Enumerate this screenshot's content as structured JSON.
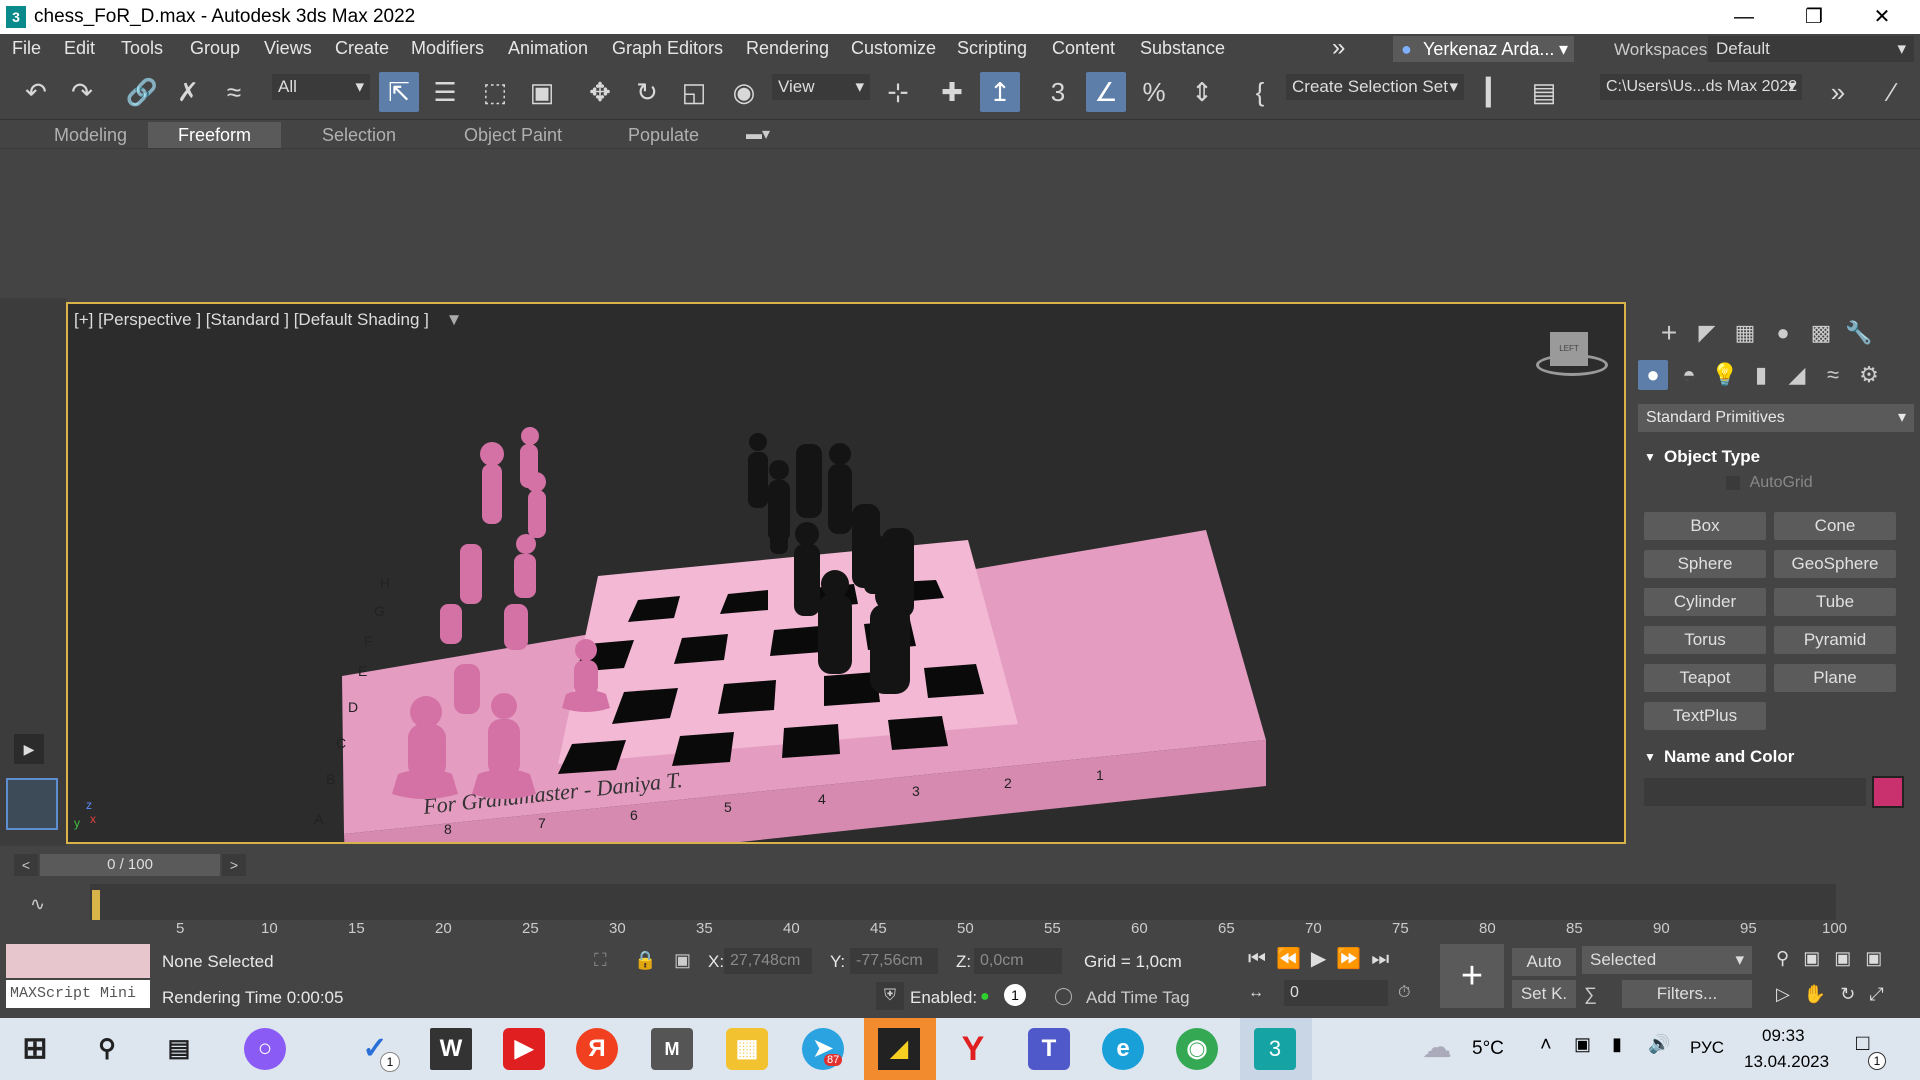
{
  "window": {
    "title": "chess_FoR_D.max - Autodesk 3ds Max 2022",
    "app_icon_label": "3"
  },
  "menu": {
    "items": [
      "File",
      "Edit",
      "Tools",
      "Group",
      "Views",
      "Create",
      "Modifiers",
      "Animation",
      "Graph Editors",
      "Rendering",
      "Customize",
      "Scripting",
      "Content",
      "Substance"
    ],
    "more": "»",
    "user": "Yerkenaz Arda...",
    "workspaces_label": "Workspaces:",
    "workspace_value": "Default"
  },
  "toolbar": {
    "filter_value": "All",
    "ref_coord_value": "View",
    "selection_set_value": "Create Selection Set",
    "path_value": "C:\\Users\\Us...ds Max 2022"
  },
  "ribbon": {
    "tabs": [
      "Modeling",
      "Freeform",
      "Selection",
      "Object Paint",
      "Populate"
    ],
    "active_tab": "Freeform"
  },
  "viewport": {
    "label": "[+] [Perspective ] [Standard ] [Default Shading ]",
    "board_inscription": "For Grandmaster - Daniya T.",
    "board_letters": [
      "A",
      "B",
      "C",
      "D",
      "E",
      "F",
      "G",
      "H"
    ],
    "board_numbers": [
      "8",
      "7",
      "6",
      "5",
      "4",
      "3",
      "2",
      "1"
    ],
    "viewcube_label": "LEFT"
  },
  "command_panel": {
    "category_dropdown": "Standard Primitives",
    "object_type_title": "Object Type",
    "autogrid_label": "AutoGrid",
    "buttons": [
      "Box",
      "Cone",
      "Sphere",
      "GeoSphere",
      "Cylinder",
      "Tube",
      "Torus",
      "Pyramid",
      "Teapot",
      "Plane",
      "TextPlus"
    ],
    "name_color_title": "Name and Color",
    "object_color": "#c8306e"
  },
  "timeline": {
    "frame_display": "0 / 100",
    "ticks": [
      "5",
      "10",
      "15",
      "20",
      "25",
      "30",
      "35",
      "40",
      "45",
      "50",
      "55",
      "60",
      "65",
      "70",
      "75",
      "80",
      "85",
      "90",
      "95",
      "100"
    ]
  },
  "status": {
    "maxscript_label": "MAXScript Mini",
    "selection_text": "None Selected",
    "rendering_time": "Rendering Time  0:00:05",
    "x_label": "X:",
    "x_value": "27,748cm",
    "y_label": "Y:",
    "y_value": "-77,56cm",
    "z_label": "Z:",
    "z_value": "0,0cm",
    "grid_text": "Grid = 1,0cm",
    "enabled_label": "Enabled:",
    "enabled_count": "1",
    "add_time_tag": "Add Time Tag",
    "auto_key": "Auto",
    "set_key": "Set K.",
    "key_filter_value": "Selected",
    "filters_label": "Filters...",
    "frame_value": "0"
  },
  "taskbar": {
    "weather_temp": "5°C",
    "language": "РУС",
    "time": "09:33",
    "date": "13.04.2023",
    "telegram_badge": "87",
    "todo_badge": "1",
    "notif_badge": "1"
  }
}
